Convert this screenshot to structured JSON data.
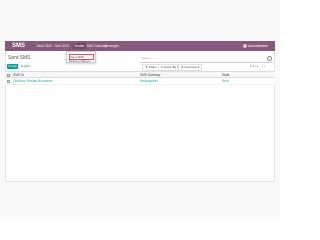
{
  "navbar": {
    "brand": "SMS",
    "menu": [
      "Send SMS",
      "Sent SMS",
      "Modes",
      "SMS Gateway",
      "Messages"
    ],
    "active_index": 2,
    "user": "Administrator"
  },
  "dropdown": {
    "items": [
      "Sent SMS",
      "Delivery Report"
    ]
  },
  "control_panel": {
    "title": "Sent SMS",
    "search_placeholder": "Search...",
    "create_label": "Create",
    "import_label": "Import",
    "filters_label": "▼ Filters ▾",
    "groupby_label": "≡ Group By ▾",
    "favorites_label": "★ Favorites ▾",
    "pager": "1-1 / 1",
    "pager_arrows": "‹  ›"
  },
  "table": {
    "columns": [
      "SMS To",
      "SMS Gateway",
      "State"
    ],
    "rows": [
      {
        "to": "Oitkhoke Bhelate Bhoosthel",
        "gateway": "Messagebird",
        "state": "Sent"
      }
    ]
  }
}
